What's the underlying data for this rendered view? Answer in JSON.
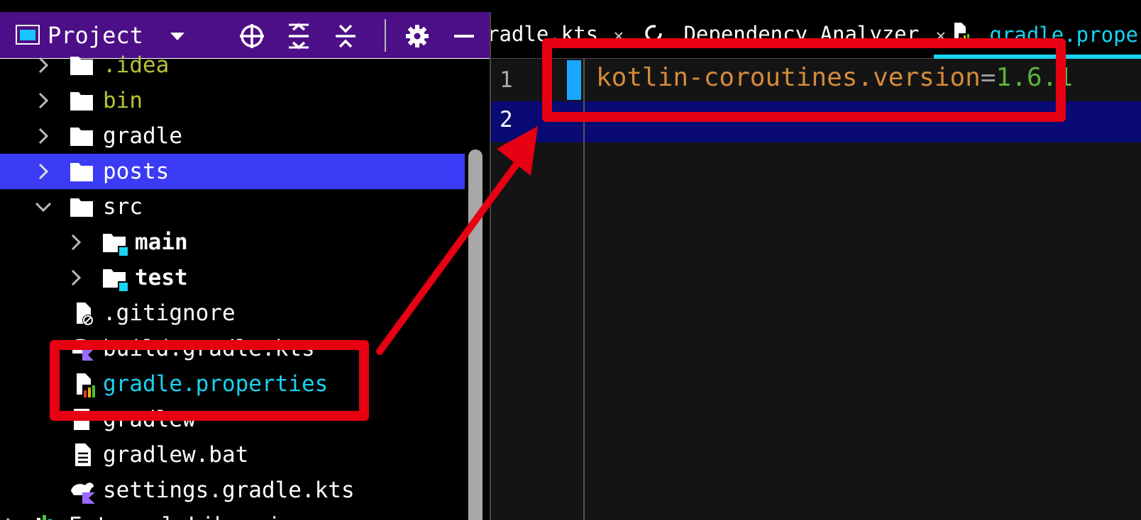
{
  "sidebar": {
    "title": "Project",
    "tree": [
      {
        "label": ".idea",
        "type": "folder",
        "color": "#b6c234",
        "chevron": "right"
      },
      {
        "label": "bin",
        "type": "folder",
        "color": "#b6c234",
        "chevron": "right"
      },
      {
        "label": "gradle",
        "type": "folder",
        "color": "#ffffff",
        "chevron": "right"
      },
      {
        "label": "posts",
        "type": "folder",
        "color": "#ffffff",
        "chevron": "right",
        "selected": true
      },
      {
        "label": "src",
        "type": "folder",
        "color": "#ffffff",
        "chevron": "down"
      },
      {
        "label": "main",
        "type": "source-folder",
        "color": "#ffffff",
        "chevron": "right",
        "bold": true
      },
      {
        "label": "test",
        "type": "test-folder",
        "color": "#ffffff",
        "chevron": "right",
        "bold": true
      },
      {
        "label": ".gitignore",
        "type": "ignore-file",
        "color": "#ffffff"
      },
      {
        "label": "build.gradle.kts",
        "type": "kotlin-gradle-file",
        "color": "#ffffff"
      },
      {
        "label": "gradle.properties",
        "type": "properties-file",
        "color": "#19d3f0"
      },
      {
        "label": "gradlew",
        "type": "script-file",
        "color": "#ffffff"
      },
      {
        "label": "gradlew.bat",
        "type": "text-file",
        "color": "#ffffff"
      },
      {
        "label": "settings.gradle.kts",
        "type": "kotlin-gradle-file",
        "color": "#ffffff"
      },
      {
        "label": "External Libraries",
        "type": "library",
        "color": "#ffffff",
        "chevron": "right"
      }
    ]
  },
  "editor": {
    "tabs": [
      {
        "label": "radle.kts",
        "icon": "none",
        "close": "✕"
      },
      {
        "label": "Dependency Analyzer",
        "icon": "refresh-icon",
        "close": "✕"
      },
      {
        "label": "gradle.propert",
        "icon": "properties-file-icon",
        "active": true
      }
    ],
    "lines": [
      {
        "number": "1",
        "key": "kotlin-coroutines.version",
        "sep": "=",
        "value": "1.6.1"
      },
      {
        "number": "2"
      }
    ]
  },
  "colors": {
    "sidebar_header_bg": "#4d0f87",
    "selection_bg": "#3b3bf5",
    "accent_cyan": "#19d3f0",
    "annotation_red": "#e60012",
    "current_line_bg": "#0a0a74",
    "property_key": "#d58a3a",
    "property_value": "#5ab43a"
  }
}
